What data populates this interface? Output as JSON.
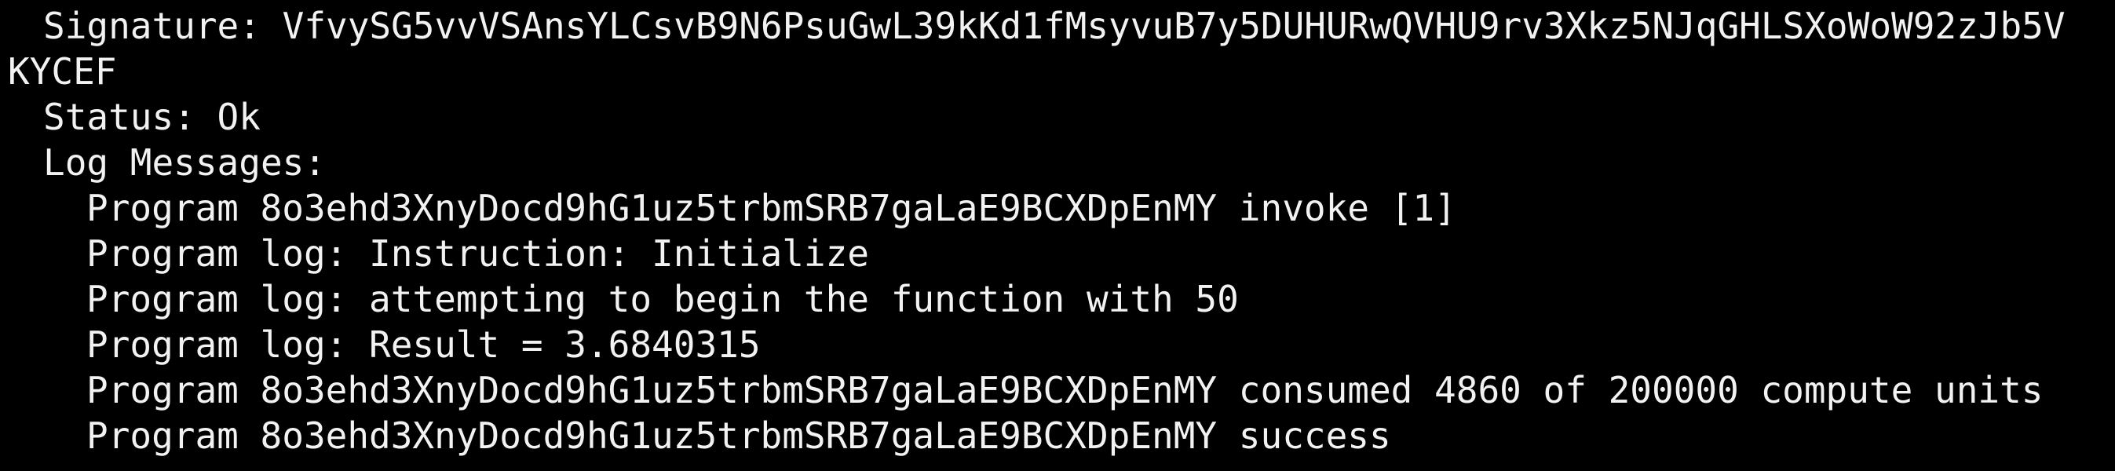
{
  "terminal": {
    "background": "#000000",
    "foreground": "#f2f2f2",
    "lines": [
      {
        "text": "Signature: VfvySG5vvVSAnsYLCsvB9N6PsuGwL39kKd1fMsyvuB7y5DUHURwQVHU9rv3Xkz5NJqGHLSXoWoW92zJb5V"
      },
      {
        "text": "KYCEF"
      },
      {
        "text": "Status: Ok"
      },
      {
        "text": "Log Messages:"
      },
      {
        "text": "Program 8o3ehd3XnyDocd9hG1uz5trbmSRB7gaLaE9BCXDpEnMY invoke [1]"
      },
      {
        "text": "Program log: Instruction: Initialize"
      },
      {
        "text": "Program log: attempting to begin the function with 50"
      },
      {
        "text": "Program log: Result = 3.6840315"
      },
      {
        "text": "Program 8o3ehd3XnyDocd9hG1uz5trbmSRB7gaLaE9BCXDpEnMY consumed 4860 of 200000 compute units"
      },
      {
        "text": "Program 8o3ehd3XnyDocd9hG1uz5trbmSRB7gaLaE9BCXDpEnMY success"
      }
    ]
  }
}
